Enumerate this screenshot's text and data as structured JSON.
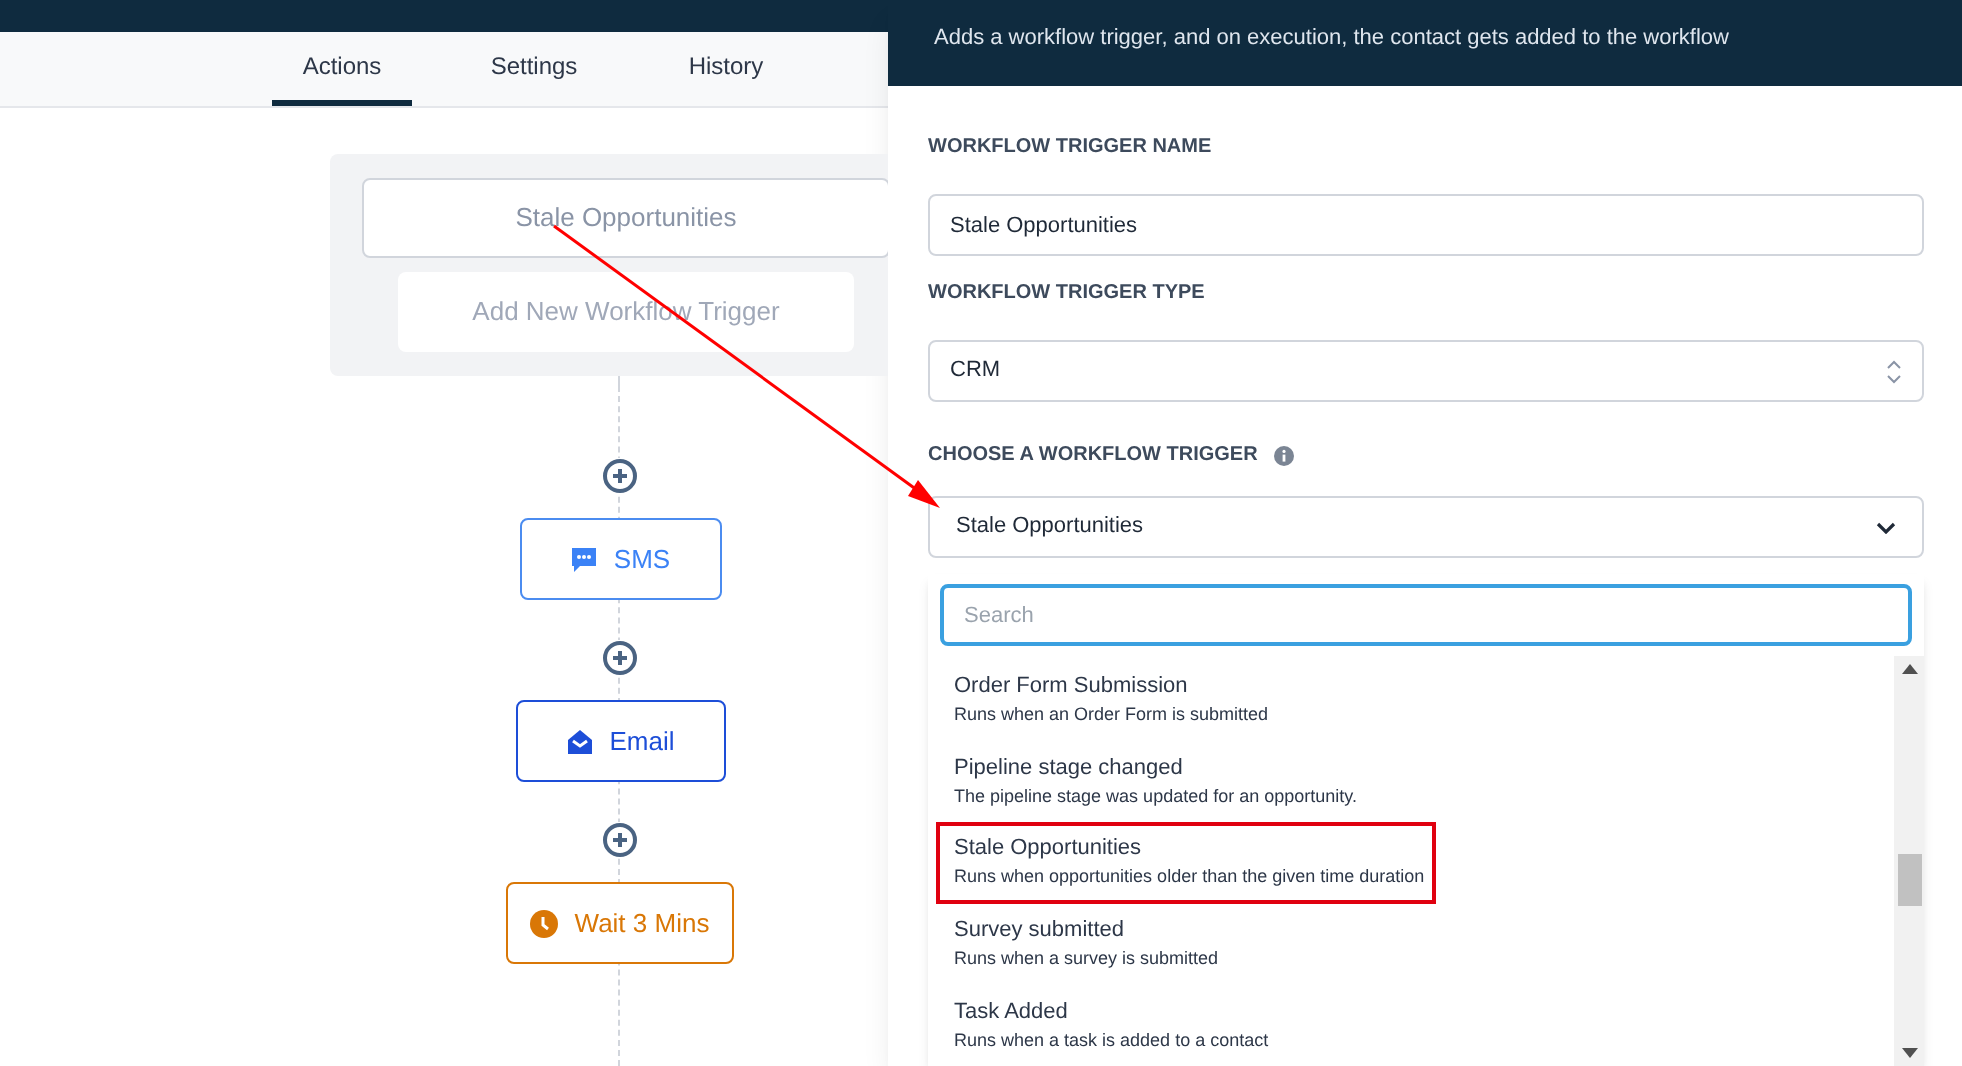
{
  "tabs": [
    {
      "label": "Actions",
      "selected": true
    },
    {
      "label": "Settings",
      "selected": false
    },
    {
      "label": "History",
      "selected": false
    }
  ],
  "trigger_group": {
    "trigger": "Stale Opportunities",
    "add_button": "Add New Workflow Trigger"
  },
  "flow_steps": [
    {
      "kind": "sms",
      "label": "SMS"
    },
    {
      "kind": "email",
      "label": "Email"
    },
    {
      "kind": "wait",
      "label": "Wait 3 Mins"
    }
  ],
  "panel": {
    "subtitle": "Adds a workflow trigger, and on execution, the contact gets added to the workflow",
    "name_label": "WORKFLOW TRIGGER NAME",
    "name_value": "Stale Opportunities",
    "type_label": "WORKFLOW TRIGGER TYPE",
    "type_value": "CRM",
    "choose_label": "CHOOSE A WORKFLOW TRIGGER",
    "choose_value": "Stale Opportunities",
    "search": {
      "placeholder": "Search"
    },
    "options": [
      {
        "title": "Order Form Submission",
        "description": "Runs when an Order Form is submitted",
        "highlighted": false
      },
      {
        "title": "Pipeline stage changed",
        "description": "The pipeline stage was updated for an opportunity.",
        "highlighted": false
      },
      {
        "title": "Stale Opportunities",
        "description": "Runs when opportunities older than the given time duration",
        "highlighted": true
      },
      {
        "title": "Survey submitted",
        "description": "Runs when a survey is submitted",
        "highlighted": false
      },
      {
        "title": "Task Added",
        "description": "Runs when a task is added to a contact",
        "highlighted": false
      }
    ]
  }
}
